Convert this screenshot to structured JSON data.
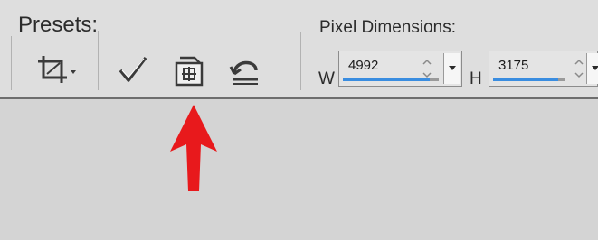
{
  "presets": {
    "label": "Presets:"
  },
  "pixel_dimensions": {
    "label": "Pixel Dimensions:",
    "width_label": "W",
    "width_value": "4992",
    "height_label": "H",
    "height_value": "3175"
  },
  "toolbar_icons": [
    "crop-preset-icon",
    "check-icon",
    "straighten-icon",
    "undo-icon"
  ],
  "colors": {
    "accent": "#3a8de0",
    "annotation_arrow": "#e8191c",
    "toolbar_bg": "#dedede",
    "canvas_bg": "#d4d4d4"
  }
}
